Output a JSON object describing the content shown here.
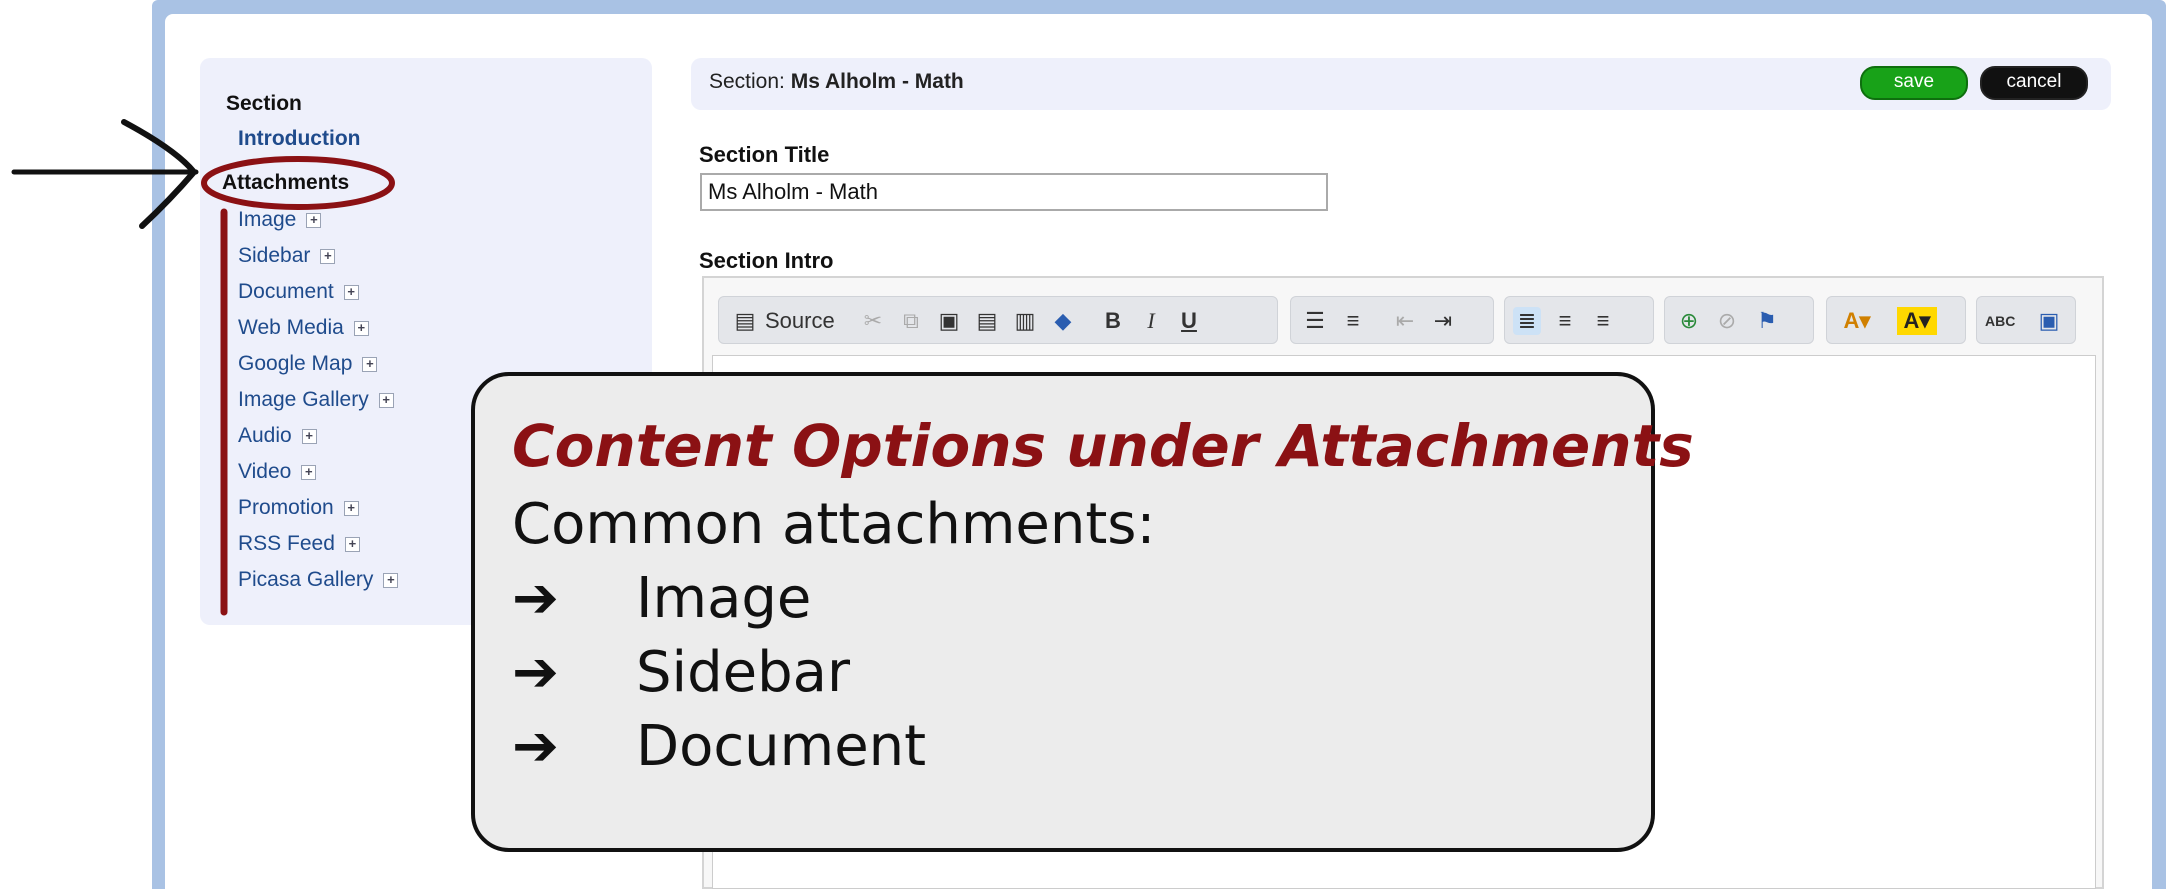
{
  "sidebar": {
    "heading": "Section",
    "intro_link": "Introduction",
    "attachments_label": "Attachments",
    "items": [
      {
        "label": "Image"
      },
      {
        "label": "Sidebar"
      },
      {
        "label": "Document"
      },
      {
        "label": "Web Media"
      },
      {
        "label": "Google Map"
      },
      {
        "label": "Image Gallery"
      },
      {
        "label": "Audio"
      },
      {
        "label": "Video"
      },
      {
        "label": "Promotion"
      },
      {
        "label": "RSS Feed"
      },
      {
        "label": "Picasa Gallery"
      }
    ]
  },
  "header": {
    "section_prefix": "Section: ",
    "section_name": "Ms Alholm - Math",
    "save_label": "save",
    "cancel_label": "cancel"
  },
  "form": {
    "title_label": "Section Title",
    "title_value": "Ms Alholm - Math",
    "intro_label": "Section Intro"
  },
  "toolbar": {
    "source_label": "Source"
  },
  "callout": {
    "title": "Content Options under Attachments",
    "subtitle": "Common attachments:",
    "bullet": "➔",
    "items": [
      "Image",
      "Sidebar",
      "Document"
    ]
  },
  "colors": {
    "annotation_red": "#8b1114",
    "frame_blue": "#a9c2e4",
    "save_green": "#18a218"
  }
}
